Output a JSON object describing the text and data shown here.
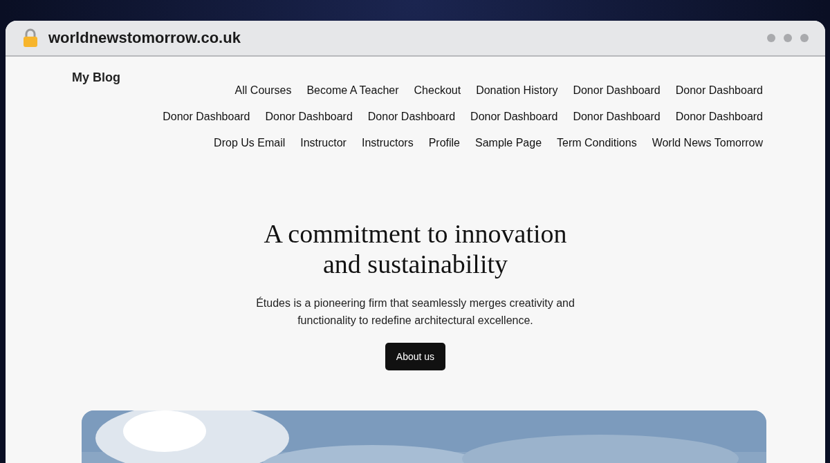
{
  "browser": {
    "url": "worldnewstomorrow.co.uk"
  },
  "site": {
    "title": "My Blog"
  },
  "nav": {
    "items": [
      "All Courses",
      "Become A Teacher",
      "Checkout",
      "Donation History",
      "Donor Dashboard",
      "Donor Dashboard",
      "Donor Dashboard",
      "Donor Dashboard",
      "Donor Dashboard",
      "Donor Dashboard",
      "Donor Dashboard",
      "Donor Dashboard",
      "Drop Us Email",
      "Instructor",
      "Instructors",
      "Profile",
      "Sample Page",
      "Term Conditions",
      "World News Tomorrow"
    ]
  },
  "hero": {
    "heading_lines": [
      "A commitment to innovation",
      "and sustainability"
    ],
    "text": "Études is a pioneering firm that seamlessly merges creativity and functionality to redefine architectural excellence.",
    "button": "About us"
  }
}
